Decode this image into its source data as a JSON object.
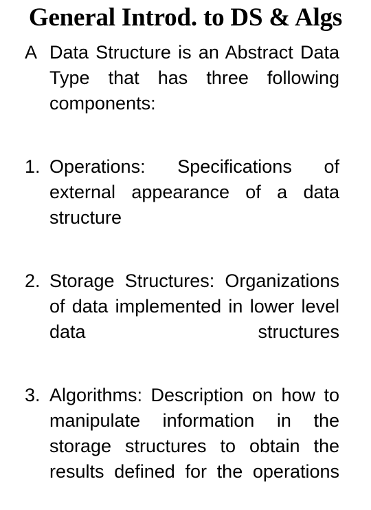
{
  "slide": {
    "title": "General Introd. to DS & Algs",
    "background_color": "#ffffff",
    "text_color": "#000000",
    "paragraphs": [
      {
        "marker": "A",
        "text": "Data Structure is an Abstract Data Type that has three following components:"
      },
      {
        "marker": "1.",
        "text": "Operations: Specifications of external appearance of a data structure"
      },
      {
        "marker": "2.",
        "text": "Storage Structures: Organizations of data implemented in lower level data structures"
      },
      {
        "marker": "3.",
        "text": "Algorithms: Description on how to manipulate information in the storage structures to obtain the results defined for the operations"
      }
    ]
  }
}
